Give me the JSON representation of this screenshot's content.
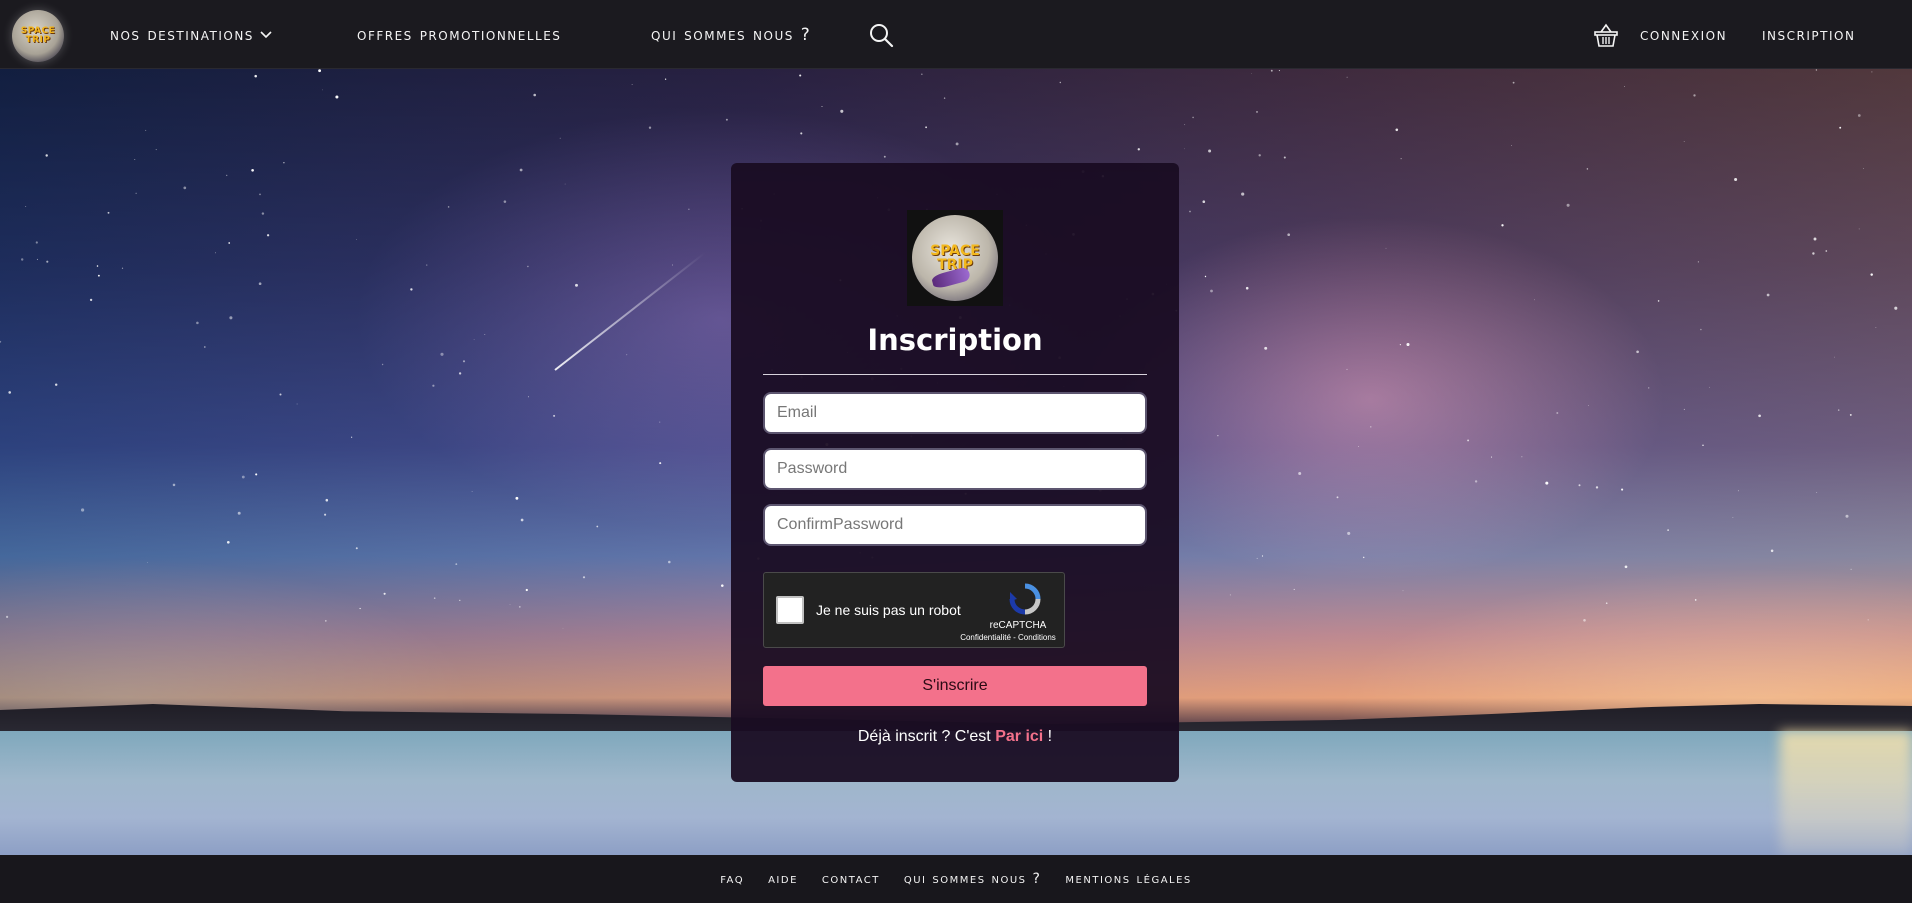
{
  "header": {
    "logo_text": "SPACE TRIP",
    "nav": {
      "destinations": "Nos destinations",
      "offres": "Offres promotionnelles",
      "about": "Qui sommes nous ?"
    },
    "right": {
      "connexion": "Connexion",
      "inscription": "Inscription"
    }
  },
  "form": {
    "logo_text": "SPACE TRIP",
    "title": "Inscription",
    "email_placeholder": "Email",
    "password_placeholder": "Password",
    "confirm_placeholder": "ConfirmPassword",
    "captcha": {
      "label": "Je ne suis pas un robot",
      "brand": "reCAPTCHA",
      "links": "Confidentialité - Conditions"
    },
    "submit": "S'inscrire",
    "already_prefix": "Déjà inscrit ? C'est ",
    "already_link": "Par ici",
    "already_suffix": " !"
  },
  "footer": {
    "links": [
      "FAQ",
      "Aide",
      "Contact",
      "Qui sommes nous ?",
      "Mentions légales"
    ]
  },
  "colors": {
    "accent": "#f3718b",
    "card_bg": "#1a0c22",
    "nav_bg": "#1b1a1f"
  },
  "icons": {
    "search": "search-icon",
    "basket": "basket-icon",
    "chevron": "chevron-down-icon"
  }
}
